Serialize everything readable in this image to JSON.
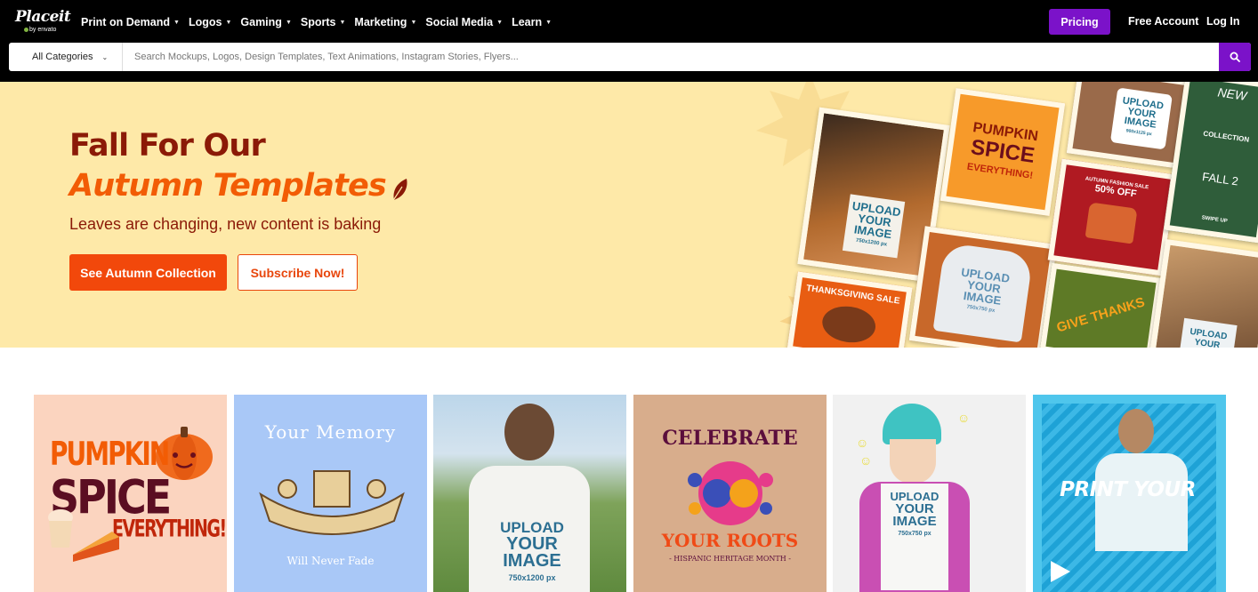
{
  "brand": {
    "name": "Placeit",
    "sub": "by envato"
  },
  "nav": {
    "items": [
      {
        "label": "Print on Demand"
      },
      {
        "label": "Logos"
      },
      {
        "label": "Gaming"
      },
      {
        "label": "Sports"
      },
      {
        "label": "Marketing"
      },
      {
        "label": "Social Media"
      },
      {
        "label": "Learn"
      }
    ],
    "pricing": "Pricing",
    "free_account": "Free Account",
    "login": "Log In"
  },
  "search": {
    "category": "All Categories",
    "placeholder": "Search Mockups, Logos, Design Templates, Text Animations, Instagram Stories, Flyers..."
  },
  "hero": {
    "title_line1": "Fall For Our",
    "title_line2": "Autumn Templates",
    "subtitle": "Leaves are changing, new content is baking",
    "primary_button": "See Autumn Collection",
    "secondary_button": "Subscribe Now!",
    "collage": {
      "pumpkin": [
        "PUMPKIN",
        "SPICE",
        "EVERYTHING!"
      ],
      "upload": [
        "UPLOAD",
        "YOUR",
        "IMAGE",
        "750x1200 px"
      ],
      "upload_mug": [
        "UPLOAD",
        "YOUR",
        "IMAGE",
        "900x1125 px"
      ],
      "upload_hoodie": [
        "UPLOAD",
        "YOUR",
        "IMAGE",
        "750x750 px"
      ],
      "upload_person": [
        "UPLOAD",
        "YOUR"
      ],
      "sale": [
        "AUTUMN FASHION SALE",
        "50% OFF"
      ],
      "thanksgiving": "THANKSGIVING SALE",
      "give_thanks": "GIVE THANKS",
      "fall": [
        "NEW",
        "COLLECTION",
        "FALL 2",
        "SWIPE UP"
      ]
    }
  },
  "tiles": [
    {
      "lines": [
        "PUMPKIN",
        "SPICE",
        "EVERYTHING!"
      ]
    },
    {
      "lines": [
        "Your Memory",
        "Will Never Fade"
      ]
    },
    {
      "lines": [
        "UPLOAD",
        "YOUR",
        "IMAGE",
        "750x1200 px"
      ]
    },
    {
      "lines": [
        "CELEBRATE",
        "YOUR ROOTS",
        "- HISPANIC HERITAGE MONTH -"
      ]
    },
    {
      "lines": [
        "UPLOAD",
        "YOUR",
        "IMAGE",
        "750x750 px"
      ]
    },
    {
      "lines": [
        "PRINT YOUR"
      ]
    }
  ],
  "colors": {
    "accent": "#7b12c9",
    "hero_bg": "#fee9a8",
    "hero_title": "#8b1a07",
    "hero_highlight": "#f25c05",
    "cta": "#f2480b"
  }
}
